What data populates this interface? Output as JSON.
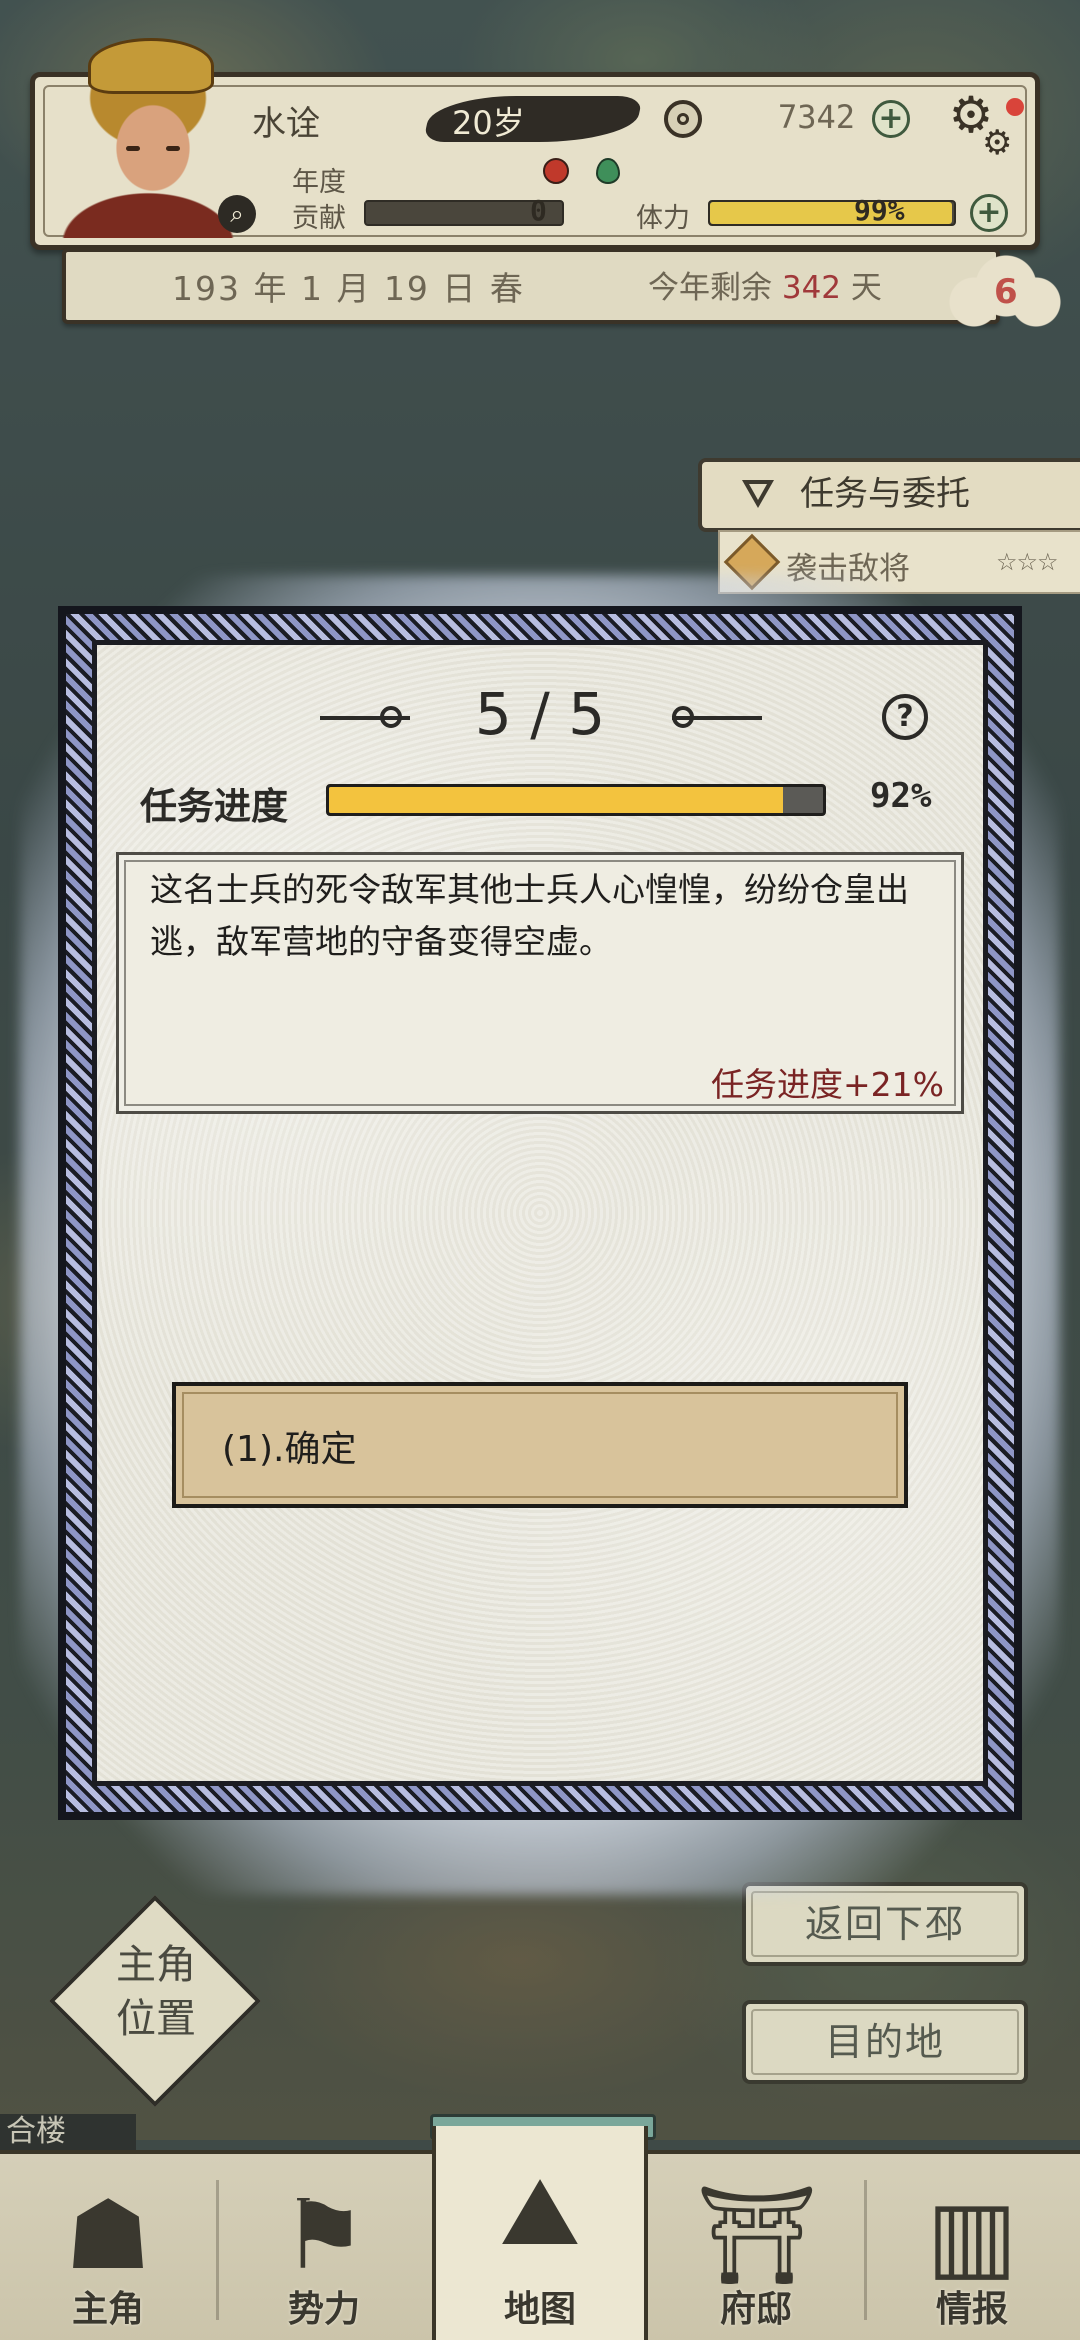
{
  "hud": {
    "name": "水诠",
    "age": "20岁",
    "money": "7342",
    "year_label": "年度",
    "contrib_label": "贡献",
    "contrib_value": "0",
    "stamina_label": "体力",
    "stamina_value": "99%",
    "stamina_level": 0.99,
    "date": "193 年 1 月 19 日 春",
    "remaining_prefix": "今年剩余",
    "remaining_days": "342",
    "remaining_suffix": "天",
    "badge_count": "6",
    "icons": [
      "magnifier-icon",
      "coin-icon",
      "gear-icon",
      "plus-icon"
    ]
  },
  "tasks": {
    "tab_label": "任务与委托",
    "items": [
      {
        "label": "袭击敌将",
        "stars": "☆☆☆"
      }
    ]
  },
  "dialog": {
    "step": "5 / 5",
    "progress_label": "任务进度",
    "progress_percent": "92%",
    "progress_value": 0.92,
    "message": "这名士兵的死令敌军其他士兵人心惶惶，纷纷仓皇出逃，敌军营地的守备变得空虚。",
    "result": "任务进度+21%",
    "choices": [
      {
        "label": "(1).确定"
      }
    ]
  },
  "side_buttons": {
    "return": "返回下邳",
    "destination": "目的地"
  },
  "locator": {
    "label_line1": "主角",
    "label_line2": "位置"
  },
  "map_label": "合楼",
  "nav": {
    "items": [
      {
        "label": "主角",
        "icon": "character-icon"
      },
      {
        "label": "势力",
        "icon": "flag-icon"
      },
      {
        "label": "地图",
        "icon": "map-icon"
      },
      {
        "label": "府邸",
        "icon": "mansion-icon"
      },
      {
        "label": "情报",
        "icon": "scroll-icon"
      }
    ],
    "active": "地图"
  },
  "colors": {
    "progress_fill": "#f3c33e",
    "stamina_fill": "#e6c84a",
    "result_text": "#7a2424",
    "dialog_border": "#9aa1cc",
    "button_bg": "#d8c39b"
  }
}
